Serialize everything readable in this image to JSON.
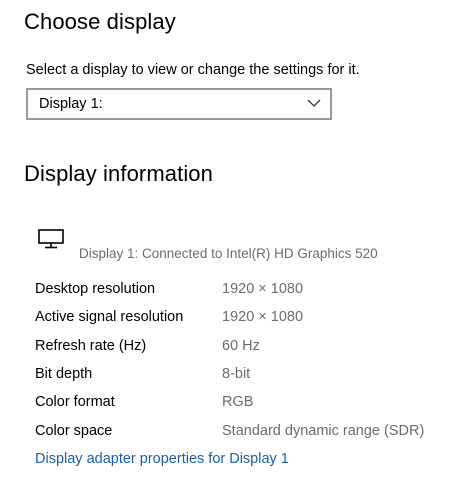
{
  "choose_display": {
    "title": "Choose display",
    "description": "Select a display to view or change the settings for it.",
    "dropdown": {
      "selected": "Display 1:",
      "icon": "chevron-down-icon"
    }
  },
  "display_information": {
    "title": "Display information",
    "monitor_icon": "monitor-icon",
    "connection": "Display 1: Connected to Intel(R) HD Graphics 520",
    "rows": [
      {
        "label": "Desktop resolution",
        "value": "1920 × 1080"
      },
      {
        "label": "Active signal resolution",
        "value": "1920 × 1080"
      },
      {
        "label": "Refresh rate (Hz)",
        "value": "60 Hz"
      },
      {
        "label": "Bit depth",
        "value": "8-bit"
      },
      {
        "label": "Color format",
        "value": "RGB"
      },
      {
        "label": "Color space",
        "value": "Standard dynamic range (SDR)"
      }
    ],
    "adapter_link": "Display adapter properties for Display 1"
  },
  "colors": {
    "link": "#1a5fa8",
    "secondary_text": "#6b6b6b",
    "dropdown_border": "#999999"
  }
}
